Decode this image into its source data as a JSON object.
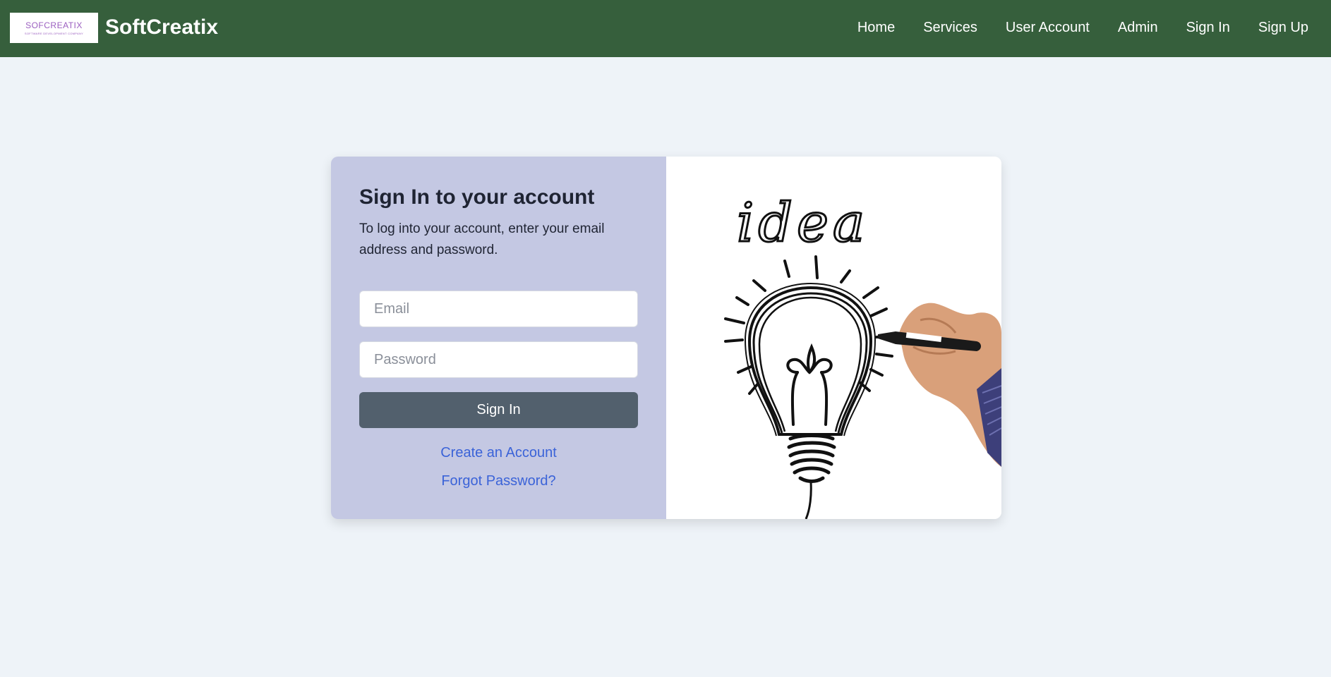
{
  "header": {
    "logo_text": "SOFCREATIX",
    "logo_subtext": "SOFTWARE DEVELOPMENT COMPANY",
    "brand": "SoftCreatix",
    "nav": [
      {
        "label": "Home"
      },
      {
        "label": "Services"
      },
      {
        "label": "User Account"
      },
      {
        "label": "Admin"
      },
      {
        "label": "Sign In"
      },
      {
        "label": "Sign Up"
      }
    ]
  },
  "signin": {
    "title": "Sign In to your account",
    "description": "To log into your account, enter your email address and password.",
    "email_placeholder": "Email",
    "password_placeholder": "Password",
    "submit_label": "Sign In",
    "create_account_label": "Create an Account",
    "forgot_password_label": "Forgot Password?"
  },
  "illustration": {
    "handwritten_text": "idea",
    "icon": "lightbulb-drawing-icon"
  },
  "colors": {
    "header_bg": "#365f3c",
    "page_bg": "#eef3f8",
    "panel_bg": "#c4c8e3",
    "button_bg": "#52606d",
    "link": "#3b63d8"
  }
}
